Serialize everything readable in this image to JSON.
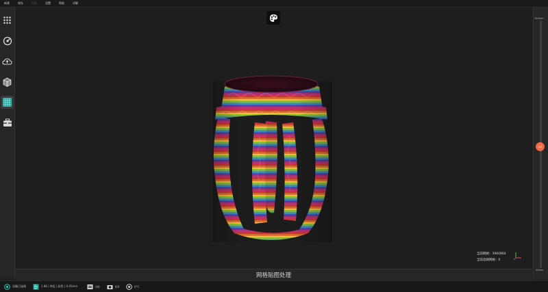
{
  "menu": {
    "items": [
      "新建",
      "保存",
      "另存",
      "设置",
      "帮助",
      "详解"
    ]
  },
  "sidebar": {
    "items": [
      {
        "icon": "grid-dots-icon"
      },
      {
        "icon": "scan-target-icon"
      },
      {
        "icon": "cloud-icon"
      },
      {
        "icon": "cube-mesh-icon"
      },
      {
        "icon": "texture-grid-icon",
        "active": true
      },
      {
        "icon": "toolbox-icon"
      }
    ]
  },
  "viewport": {
    "toolbar_icon": "palette-icon",
    "stats": {
      "mesh_count": "当前网格：3960864",
      "selected_mesh": "当前选择网格：0"
    }
  },
  "caption": "网格贴图处理",
  "slider": {
    "top_label": "150mm",
    "bottom_label": "20mm",
    "value_label": "0.0",
    "level": 0.51
  },
  "statusbar": {
    "items": [
      {
        "icon": "device-icon",
        "text": "设备已连接"
      },
      {
        "icon": "scan-mode-icon",
        "text": "1.86 | 特征 | 彩色 | 0.45mm"
      },
      {
        "icon": "point-icon",
        "text": "0/0"
      },
      {
        "icon": "camera-icon",
        "text": "0/0"
      },
      {
        "icon": "temperature-icon",
        "text": "0°C"
      }
    ]
  },
  "colors": {
    "accent": "#ef6a48",
    "active_icon": "#33c4b8",
    "background": "#1e1e1e"
  }
}
